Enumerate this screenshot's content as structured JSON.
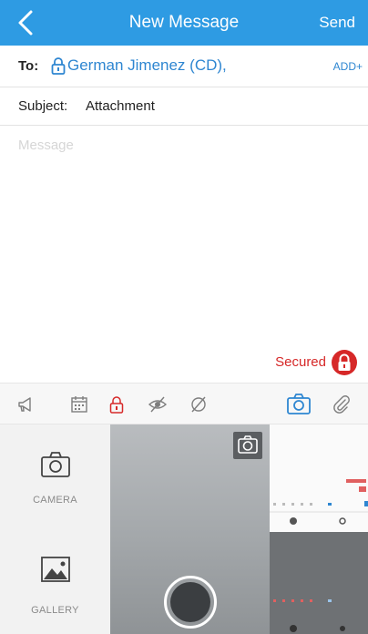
{
  "header": {
    "title": "New Message",
    "send_label": "Send",
    "background": "#2e9be3"
  },
  "to": {
    "label": "To:",
    "recipient": "German Jimenez (CD),",
    "add_label": "ADD+"
  },
  "subject": {
    "label": "Subject:",
    "value": "Attachment"
  },
  "message": {
    "placeholder": "Message"
  },
  "security": {
    "label": "Secured",
    "color": "#d62828"
  },
  "toolbar": {
    "icons": [
      "megaphone-icon",
      "calendar-icon",
      "lock-icon",
      "eye-slash-icon",
      "no-eye-icon",
      "camera-icon",
      "paperclip-icon"
    ],
    "active_color": "#2e86d1"
  },
  "picker": {
    "camera_label": "CAMERA",
    "gallery_label": "GALLERY"
  }
}
